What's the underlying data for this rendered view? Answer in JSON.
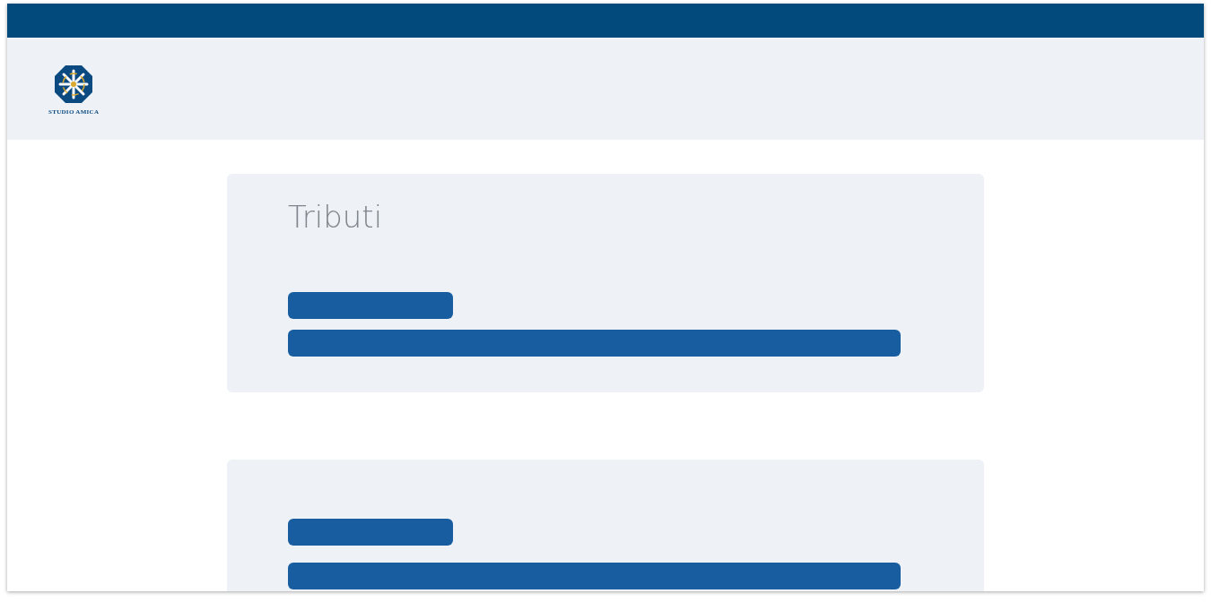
{
  "header": {
    "logo_text": "STUDIO AMICA"
  },
  "cards": [
    {
      "kind": "titled",
      "title": "Tributi"
    },
    {
      "kind": "untitled"
    }
  ]
}
